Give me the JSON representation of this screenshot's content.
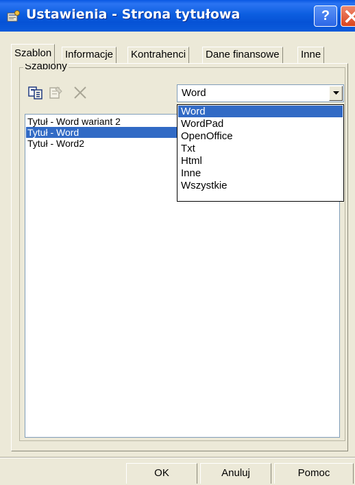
{
  "window": {
    "title": "Ustawienia - Strona tytułowa",
    "help_label": "?"
  },
  "tabs": [
    {
      "label": "Szablon",
      "active": true
    },
    {
      "label": "Informacje",
      "active": false
    },
    {
      "label": "Kontrahenci",
      "active": false
    },
    {
      "label": "Dane finansowe",
      "active": false
    },
    {
      "label": "Inne",
      "active": false
    }
  ],
  "templates_group": {
    "label": "Szablony",
    "toolbar": [
      {
        "icon": "copy-icon",
        "enabled": true
      },
      {
        "icon": "properties-icon",
        "enabled": false
      },
      {
        "icon": "delete-icon",
        "enabled": false
      }
    ],
    "filter": {
      "value": "Word",
      "options": [
        "Word",
        "WordPad",
        "OpenOffice",
        "Txt",
        "Html",
        "Inne",
        "Wszystkie"
      ],
      "selected_index": 0
    },
    "items": [
      {
        "label": "Tytuł - Word wariant 2",
        "selected": false
      },
      {
        "label": "Tytuł - Word",
        "selected": true
      },
      {
        "label": "Tytuł - Word2",
        "selected": false
      }
    ]
  },
  "buttons": {
    "ok": "OK",
    "cancel": "Anuluj",
    "help": "Pomoc"
  },
  "colors": {
    "selection": "#316ac5",
    "dialog_bg": "#ece9d8",
    "titlebar": "#0a58e3"
  }
}
